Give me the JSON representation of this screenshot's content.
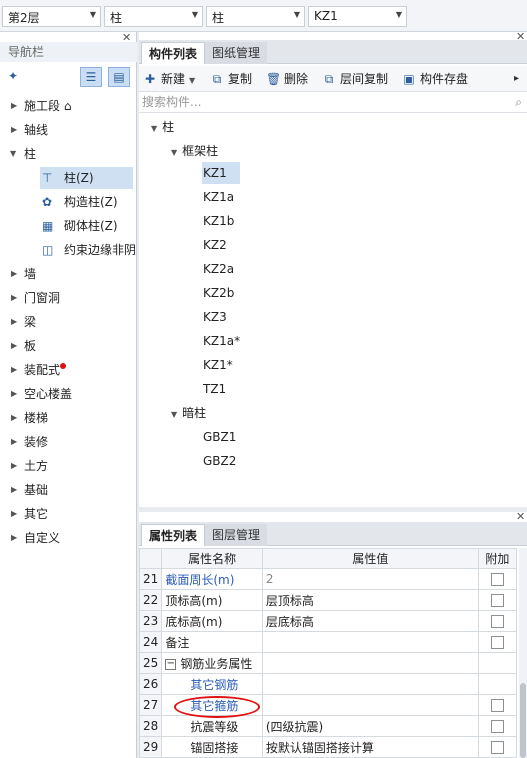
{
  "topbar": {
    "selectors": [
      {
        "value": "第2层"
      },
      {
        "value": "柱"
      },
      {
        "value": "柱"
      },
      {
        "value": "KZ1"
      }
    ]
  },
  "nav": {
    "title": "导航栏",
    "items": [
      {
        "label": "施工段 ⌂",
        "expanded": false
      },
      {
        "label": "轴线",
        "expanded": false
      },
      {
        "label": "柱",
        "expanded": true
      },
      {
        "label": "墙",
        "expanded": false
      },
      {
        "label": "门窗洞",
        "expanded": false
      },
      {
        "label": "梁",
        "expanded": false
      },
      {
        "label": "板",
        "expanded": false
      },
      {
        "label": "装配式",
        "expanded": false,
        "badge_color": "#e01010"
      },
      {
        "label": "空心楼盖",
        "expanded": false
      },
      {
        "label": "楼梯",
        "expanded": false
      },
      {
        "label": "装修",
        "expanded": false
      },
      {
        "label": "土方",
        "expanded": false
      },
      {
        "label": "基础",
        "expanded": false
      },
      {
        "label": "其它",
        "expanded": false
      },
      {
        "label": "自定义",
        "expanded": false
      }
    ],
    "sub_items": [
      {
        "label": "柱(Z)",
        "icon": "column-icon",
        "selected": true
      },
      {
        "label": "构造柱(Z)",
        "icon": "struct-column-icon",
        "selected": false
      },
      {
        "label": "砌体柱(Z)",
        "icon": "masonry-column-icon",
        "selected": false
      },
      {
        "label": "约束边缘非阴",
        "icon": "edge-column-icon",
        "selected": false
      }
    ]
  },
  "components": {
    "tabs": [
      {
        "label": "构件列表",
        "active": true
      },
      {
        "label": "图纸管理",
        "active": false
      }
    ],
    "toolbar": {
      "new": "新建",
      "copy": "复制",
      "delete": "删除",
      "floor_copy": "层间复制",
      "save": "构件存盘",
      "more": "▸"
    },
    "search_placeholder": "搜索构件...",
    "tree": {
      "root": "柱",
      "group1": "框架柱",
      "group1_items": [
        "KZ1",
        "KZ1a",
        "KZ1b",
        "KZ2",
        "KZ2a",
        "KZ2b",
        "KZ3",
        "KZ1a*",
        "KZ1*",
        "TZ1"
      ],
      "group2": "暗柱",
      "group2_items": [
        "GBZ1",
        "GBZ2"
      ],
      "selected": "KZ1"
    }
  },
  "properties": {
    "tabs": [
      {
        "label": "属性列表",
        "active": true
      },
      {
        "label": "图层管理",
        "active": false
      }
    ],
    "headers": {
      "name": "属性名称",
      "value": "属性值",
      "add": "附加"
    },
    "rows": [
      {
        "num": "21",
        "name": "截面周长(m)",
        "value": "2",
        "checkbox": true,
        "name_style": "blue",
        "value_style": "gray"
      },
      {
        "num": "22",
        "name": "顶标高(m)",
        "value": "层顶标高",
        "checkbox": true
      },
      {
        "num": "23",
        "name": "底标高(m)",
        "value": "层底标高",
        "checkbox": true
      },
      {
        "num": "24",
        "name": "备注",
        "value": "",
        "checkbox": true
      },
      {
        "num": "25",
        "name": "钢筋业务属性",
        "value": "",
        "checkbox": false,
        "group": true
      },
      {
        "num": "26",
        "name": "其它钢筋",
        "value": "",
        "checkbox": false,
        "name_style": "blue",
        "indent": true
      },
      {
        "num": "27",
        "name": "其它箍筋",
        "value": "",
        "checkbox": true,
        "name_style": "blue",
        "indent": true
      },
      {
        "num": "28",
        "name": "抗震等级",
        "value": "(四级抗震)",
        "checkbox": true,
        "indent": true
      },
      {
        "num": "29",
        "name": "锚固搭接",
        "value": "按默认锚固搭接计算",
        "checkbox": true,
        "indent": true
      }
    ],
    "group_toggle": "−"
  },
  "colors": {
    "accent_blue": "#2a5cb8",
    "selection": "#cfe0f3",
    "highlight_oval": "#e01010"
  }
}
